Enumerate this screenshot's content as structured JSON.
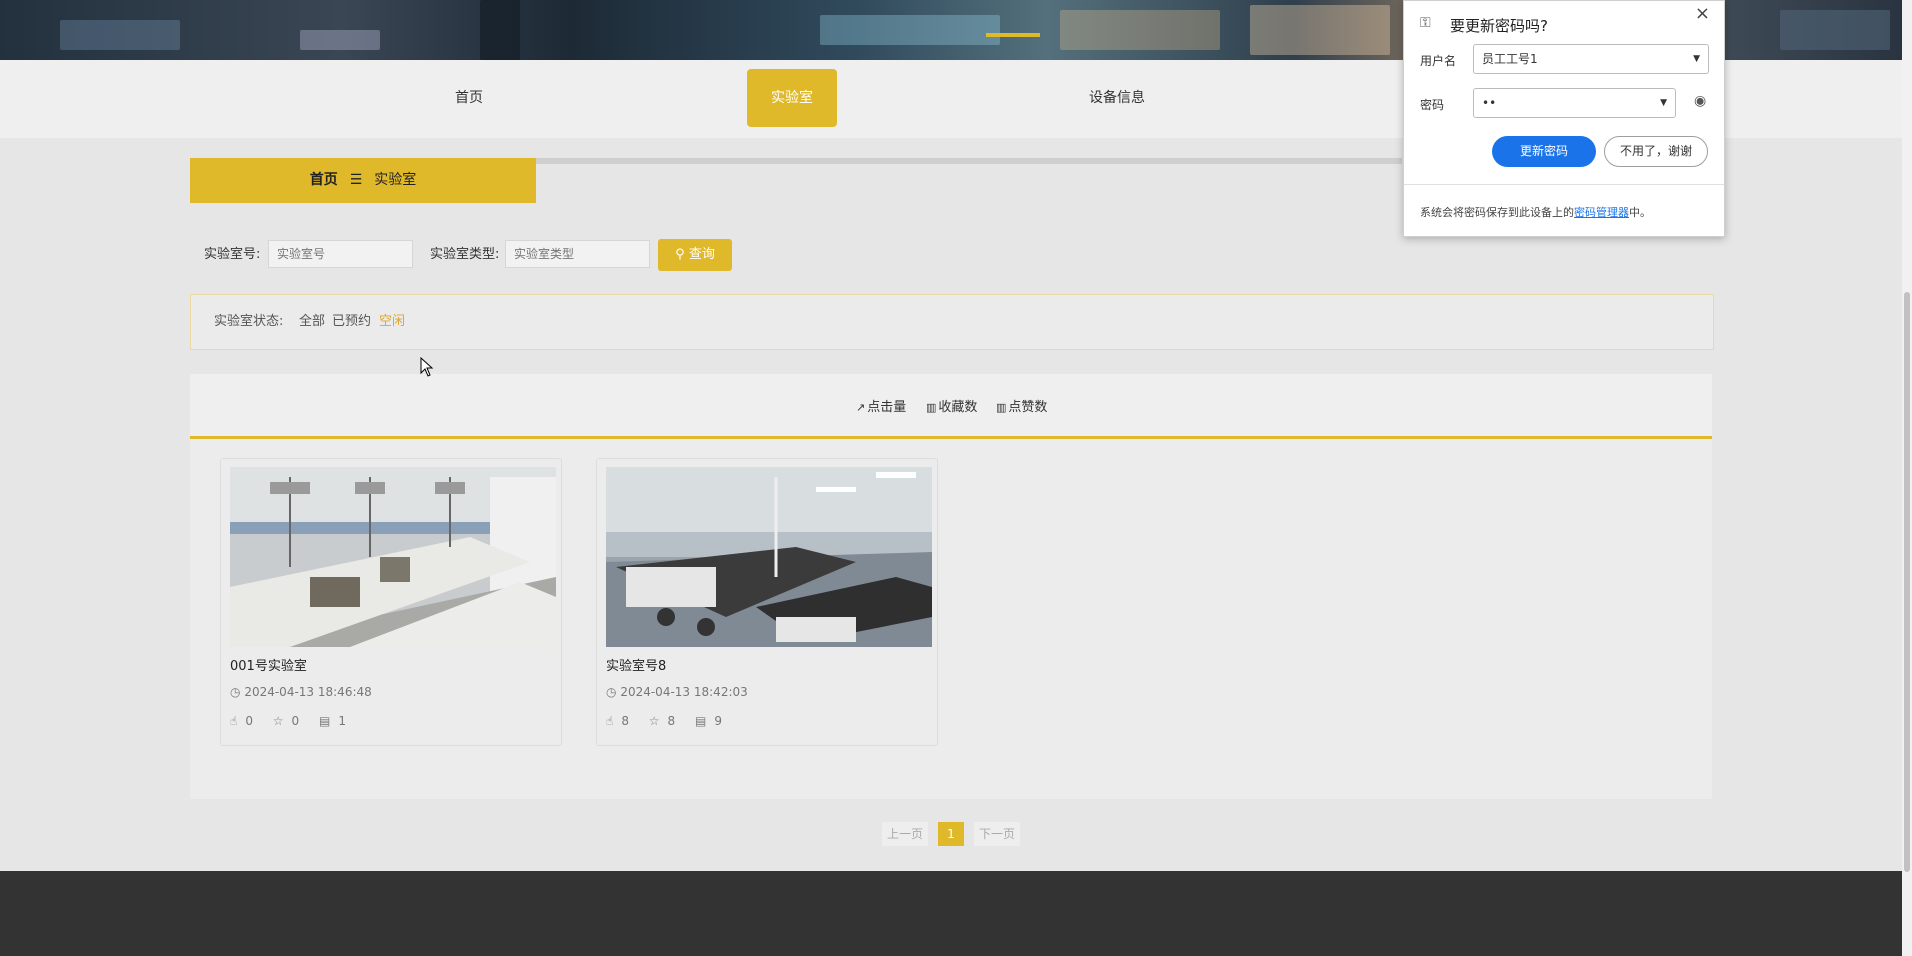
{
  "nav": {
    "items": [
      {
        "label": "首页",
        "active": false
      },
      {
        "label": "实验室",
        "active": true
      },
      {
        "label": "设备信息",
        "active": false
      }
    ]
  },
  "breadcrumb": {
    "home": "首页",
    "separator": "☰",
    "current": "实验室"
  },
  "search": {
    "lab_no_label": "实验室号:",
    "lab_no_placeholder": "实验室号",
    "lab_type_label": "实验室类型:",
    "lab_type_placeholder": "实验室类型",
    "query_label": "查询"
  },
  "status_filter": {
    "label": "实验室状态:",
    "options": [
      "全部",
      "已预约",
      "空闲"
    ],
    "selected": "空闲"
  },
  "sort": {
    "items": [
      "点击量",
      "收藏数",
      "点赞数"
    ]
  },
  "cards": [
    {
      "title": "001号实验室",
      "time": "2024-04-13 18:46:48",
      "likes": "0",
      "favorites": "0",
      "comments": "1"
    },
    {
      "title": "实验室号8",
      "time": "2024-04-13 18:42:03",
      "likes": "8",
      "favorites": "8",
      "comments": "9"
    }
  ],
  "pager": {
    "prev": "上一页",
    "current": "1",
    "next": "下一页"
  },
  "password_popup": {
    "title": "要更新密码吗?",
    "username_label": "用户名",
    "username_value": "员工工号1",
    "password_label": "密码",
    "password_value": "••",
    "update_button": "更新密码",
    "decline_button": "不用了，谢谢",
    "note_prefix": "系统会将密码保存到此设备上的",
    "note_link": "密码管理器",
    "note_suffix": "中。"
  },
  "colors": {
    "accent": "#e0b92b",
    "link_blue": "#1a73e8",
    "footer": "#333333"
  }
}
